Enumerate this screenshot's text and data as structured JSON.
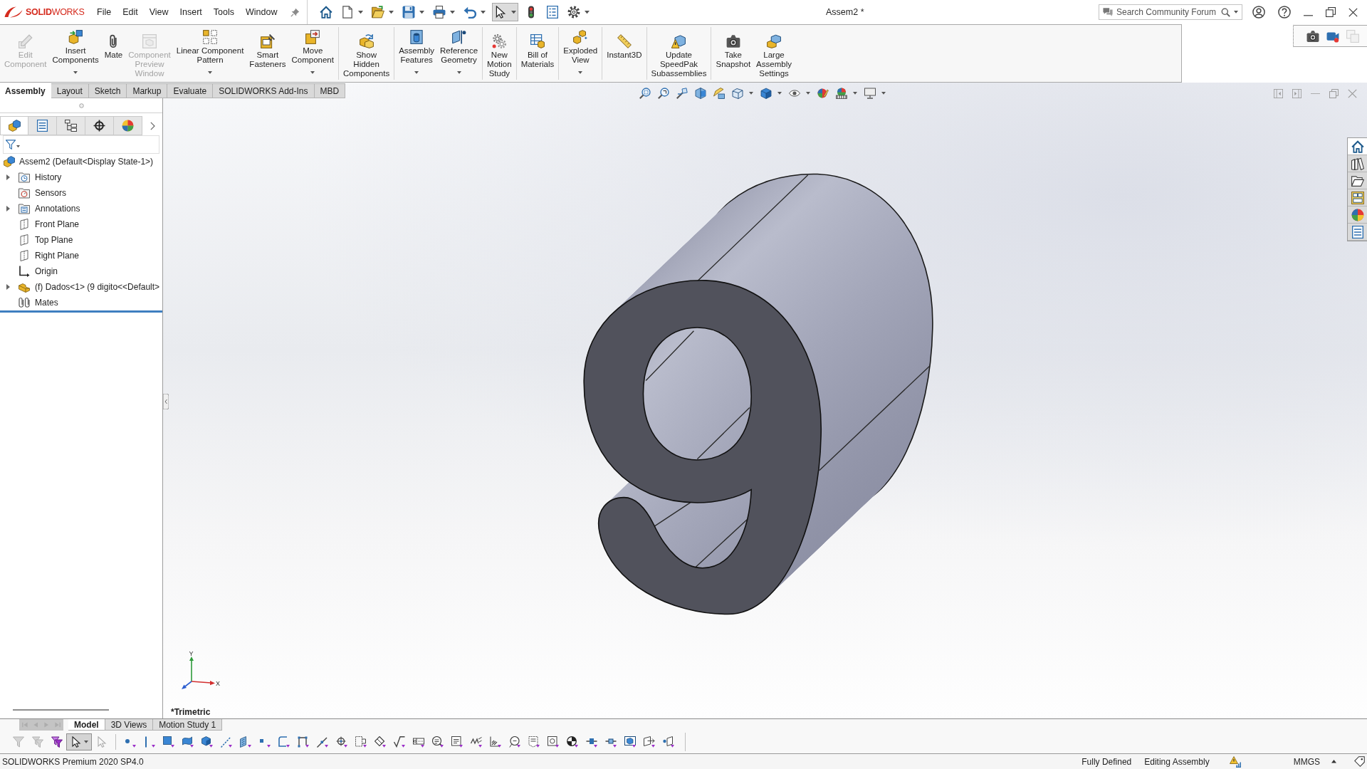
{
  "title_bar": {
    "logo": "**SOLID**WORKS",
    "menu": [
      "File",
      "Edit",
      "View",
      "Insert",
      "Tools",
      "Window"
    ],
    "quick_access": [
      {
        "dropdown": false,
        "selected": false
      },
      {
        "dropdown": true,
        "selected": false
      },
      {
        "dropdown": true,
        "selected": false
      },
      {
        "dropdown": true,
        "selected": false
      },
      {
        "dropdown": true,
        "selected": false
      },
      {
        "dropdown": true,
        "selected": false
      },
      {
        "dropdown": true,
        "selected": true
      },
      {
        "dropdown": false,
        "selected": false
      },
      {
        "dropdown": false,
        "selected": false
      },
      {
        "dropdown": true,
        "selected": false
      }
    ],
    "title": "Assem2 *",
    "search": {
      "placeholder": "Search Community Forum"
    }
  },
  "command_manager": {
    "groups": [
      {
        "buttons": [
          {
            "label": "Edit\nComponent",
            "disabled": true,
            "dropdown": false
          },
          {
            "label": "Insert\nComponents",
            "disabled": false,
            "dropdown": true
          },
          {
            "label": "Mate",
            "disabled": false,
            "dropdown": false
          },
          {
            "label": "Component\nPreview\nWindow",
            "disabled": true,
            "dropdown": false
          },
          {
            "label": "Linear Component\nPattern",
            "disabled": false,
            "dropdown": true
          },
          {
            "label": "Smart\nFasteners",
            "disabled": false,
            "dropdown": false
          },
          {
            "label": "Move\nComponent",
            "disabled": false,
            "dropdown": true
          }
        ]
      },
      {
        "buttons": [
          {
            "label": "Show\nHidden\nComponents",
            "disabled": false,
            "dropdown": false
          }
        ]
      },
      {
        "buttons": [
          {
            "label": "Assembly\nFeatures",
            "disabled": false,
            "dropdown": true
          },
          {
            "label": "Reference\nGeometry",
            "disabled": false,
            "dropdown": true
          }
        ]
      },
      {
        "buttons": [
          {
            "label": "New\nMotion\nStudy",
            "disabled": false,
            "dropdown": false
          }
        ]
      },
      {
        "buttons": [
          {
            "label": "Bill of\nMaterials",
            "disabled": false,
            "dropdown": false
          }
        ]
      },
      {
        "buttons": [
          {
            "label": "Exploded\nView",
            "disabled": false,
            "dropdown": true
          }
        ]
      },
      {
        "buttons": [
          {
            "label": "Instant3D",
            "disabled": false,
            "dropdown": false
          }
        ]
      },
      {
        "buttons": [
          {
            "label": "Update\nSpeedPak\nSubassemblies",
            "disabled": false,
            "dropdown": false
          }
        ]
      },
      {
        "buttons": [
          {
            "label": "Take\nSnapshot",
            "disabled": false,
            "dropdown": false
          },
          {
            "label": "Large\nAssembly\nSettings",
            "disabled": false,
            "dropdown": false
          }
        ]
      }
    ]
  },
  "capture_toolbar": [
    {
      "disabled": false
    },
    {
      "disabled": false
    },
    {
      "disabled": true
    }
  ],
  "command_tabs": [
    {
      "label": "Assembly",
      "selected": true
    },
    {
      "label": "Layout",
      "selected": false
    },
    {
      "label": "Sketch",
      "selected": false
    },
    {
      "label": "Markup",
      "selected": false
    },
    {
      "label": "Evaluate",
      "selected": false
    },
    {
      "label": "SOLIDWORKS Add-Ins",
      "selected": false
    },
    {
      "label": "MBD",
      "selected": false
    }
  ],
  "view_toolbar": [
    {
      "dropdown": false
    },
    {
      "dropdown": false
    },
    {
      "dropdown": false
    },
    {
      "dropdown": false
    },
    {
      "dropdown": false
    },
    {
      "dropdown": true
    },
    {
      "dropdown": true
    },
    {
      "dropdown": true
    },
    {
      "dropdown": false
    },
    {
      "dropdown": true
    },
    {
      "dropdown": true
    }
  ],
  "feature_manager": {
    "tabs": [
      {
        "selected": true
      },
      {
        "selected": false
      },
      {
        "selected": false
      },
      {
        "selected": false
      },
      {
        "selected": false
      }
    ],
    "tree": {
      "label": "Assem2 (Default<Display State-1>)",
      "children": [
        {
          "label": "History",
          "expandable": true
        },
        {
          "label": "Sensors",
          "expandable": false
        },
        {
          "label": "Annotations",
          "expandable": true
        },
        {
          "label": "Front Plane",
          "expandable": false
        },
        {
          "label": "Top Plane",
          "expandable": false
        },
        {
          "label": "Right Plane",
          "expandable": false
        },
        {
          "label": "Origin",
          "expandable": false
        },
        {
          "label": "(f) Dados<1> (9 digito<<Default>",
          "expandable": true
        },
        {
          "label": "Mates",
          "expandable": false
        }
      ]
    }
  },
  "graphics_area": {
    "triad": {
      "x": "X",
      "y": "Y"
    },
    "view_name": "*Trimetric"
  },
  "task_pane": [
    {
      "selected": true
    },
    {
      "selected": false
    },
    {
      "selected": false
    },
    {
      "selected": false
    },
    {
      "selected": false
    },
    {
      "selected": false
    }
  ],
  "model_tabs": {
    "scroll_buttons": [
      {
        "disabled": true
      },
      {
        "disabled": true
      },
      {
        "disabled": true
      },
      {
        "disabled": true
      }
    ],
    "tabs": [
      {
        "label": "Model",
        "selected": true
      },
      {
        "label": "3D Views",
        "selected": false
      },
      {
        "label": "Motion Study 1",
        "selected": false
      }
    ]
  },
  "selection_filter_toolbar": {
    "groups": [
      {
        "items": [
          {
            "disabled": true,
            "selected": false,
            "dropdown": false
          },
          {
            "disabled": true,
            "selected": false,
            "dropdown": false
          },
          {
            "disabled": false,
            "selected": false,
            "dropdown": false
          },
          {
            "disabled": false,
            "selected": true,
            "dropdown": true
          },
          {
            "disabled": true,
            "selected": false,
            "dropdown": false
          }
        ]
      },
      {
        "items": [
          {
            "disabled": false,
            "selected": false
          },
          {
            "disabled": false,
            "selected": false
          },
          {
            "disabled": false,
            "selected": false
          },
          {
            "disabled": false,
            "selected": false
          },
          {
            "disabled": false,
            "selected": false
          },
          {
            "disabled": false,
            "selected": false
          },
          {
            "disabled": false,
            "selected": false
          },
          {
            "disabled": false,
            "selected": false
          },
          {
            "disabled": false,
            "selected": false
          },
          {
            "disabled": false,
            "selected": false
          },
          {
            "disabled": false,
            "selected": false
          },
          {
            "disabled": false,
            "selected": false
          },
          {
            "disabled": false,
            "selected": false
          },
          {
            "disabled": false,
            "selected": false
          },
          {
            "disabled": false,
            "selected": false
          },
          {
            "disabled": false,
            "selected": false
          },
          {
            "disabled": false,
            "selected": false
          },
          {
            "disabled": false,
            "selected": false
          },
          {
            "disabled": false,
            "selected": false
          },
          {
            "disabled": false,
            "selected": false
          },
          {
            "disabled": false,
            "selected": false
          },
          {
            "disabled": false,
            "selected": false
          },
          {
            "disabled": false,
            "selected": false
          },
          {
            "disabled": false,
            "selected": false
          },
          {
            "disabled": false,
            "selected": false
          },
          {
            "disabled": false,
            "selected": false
          },
          {
            "disabled": false,
            "selected": false
          },
          {
            "disabled": false,
            "selected": false
          },
          {
            "disabled": false,
            "selected": false
          }
        ]
      }
    ]
  },
  "status_bar": {
    "product": "SOLIDWORKS Premium 2020 SP4.0",
    "sketch_state": "Fully Defined",
    "mode": "Editing Assembly",
    "units": "MMGS"
  }
}
